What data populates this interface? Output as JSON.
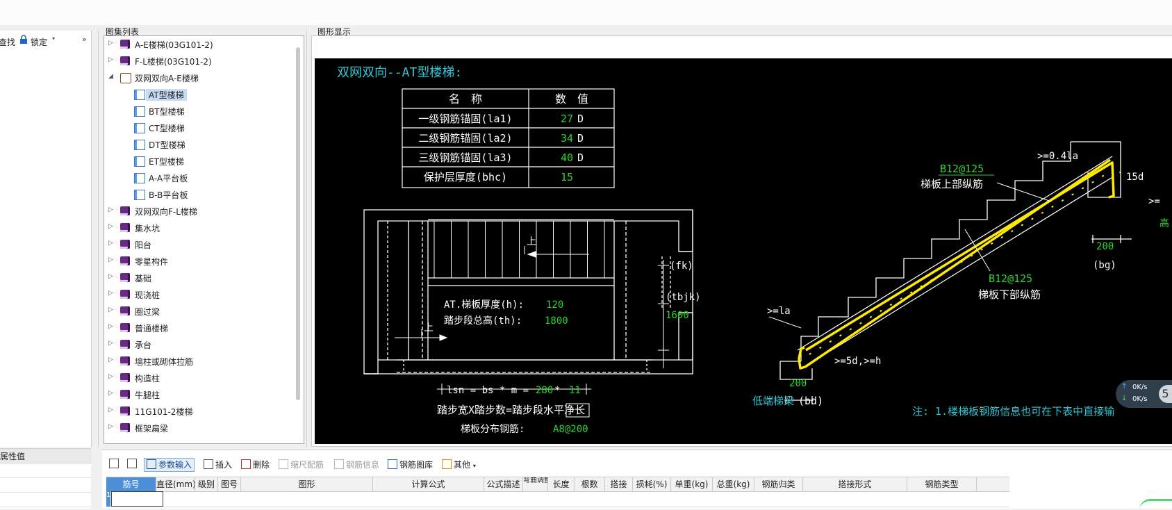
{
  "left_toolbar": {
    "find": "查找",
    "lock": "锁定"
  },
  "left_props": {
    "header": "属性值"
  },
  "tree_group_label": "图集列表",
  "graphic_group_label": "图形显示",
  "tree": [
    {
      "label": "A-E楼梯(03G101-2)",
      "level": 0,
      "expanded": false,
      "icon": "book-icon"
    },
    {
      "label": "F-L楼梯(03G101-2)",
      "level": 0,
      "expanded": false,
      "icon": "book-icon"
    },
    {
      "label": "双网双向A-E楼梯",
      "level": 0,
      "expanded": true,
      "icon": "open-book-icon"
    },
    {
      "label": "AT型楼梯",
      "level": 1,
      "selected": true,
      "icon": "page-icon"
    },
    {
      "label": "BT型楼梯",
      "level": 1,
      "icon": "page-icon"
    },
    {
      "label": "CT型楼梯",
      "level": 1,
      "icon": "page-icon"
    },
    {
      "label": "DT型楼梯",
      "level": 1,
      "icon": "page-icon"
    },
    {
      "label": "ET型楼梯",
      "level": 1,
      "icon": "page-icon"
    },
    {
      "label": "A-A平台板",
      "level": 1,
      "icon": "page-icon"
    },
    {
      "label": "B-B平台板",
      "level": 1,
      "icon": "page-icon"
    },
    {
      "label": "双网双向F-L楼梯",
      "level": 0,
      "expanded": false,
      "icon": "book-icon"
    },
    {
      "label": "集水坑",
      "level": 0,
      "expanded": false,
      "icon": "book-icon"
    },
    {
      "label": "阳台",
      "level": 0,
      "expanded": false,
      "icon": "book-icon"
    },
    {
      "label": "零星构件",
      "level": 0,
      "expanded": false,
      "icon": "book-icon"
    },
    {
      "label": "基础",
      "level": 0,
      "expanded": false,
      "icon": "book-icon"
    },
    {
      "label": "现浇桩",
      "level": 0,
      "expanded": false,
      "icon": "book-icon"
    },
    {
      "label": "圈过梁",
      "level": 0,
      "expanded": false,
      "icon": "book-icon"
    },
    {
      "label": "普通楼梯",
      "level": 0,
      "expanded": false,
      "icon": "book-icon"
    },
    {
      "label": "承台",
      "level": 0,
      "expanded": false,
      "icon": "book-icon"
    },
    {
      "label": "墙柱或砌体拉筋",
      "level": 0,
      "expanded": false,
      "icon": "book-icon"
    },
    {
      "label": "构造柱",
      "level": 0,
      "expanded": false,
      "icon": "book-icon"
    },
    {
      "label": "牛腿柱",
      "level": 0,
      "expanded": false,
      "icon": "book-icon"
    },
    {
      "label": "11G101-2楼梯",
      "level": 0,
      "expanded": false,
      "icon": "book-icon"
    },
    {
      "label": "框架扁梁",
      "level": 0,
      "expanded": false,
      "icon": "book-icon"
    }
  ],
  "drawing": {
    "title": "双网双向--AT型楼梯:",
    "table_headers": [
      "名　称",
      "数　值"
    ],
    "table_rows": [
      {
        "name": "一级钢筋锚固(la1)",
        "value": "27",
        "unit": "D"
      },
      {
        "name": "二级钢筋锚固(la2)",
        "value": "34",
        "unit": "D"
      },
      {
        "name": "三级钢筋锚固(la3)",
        "value": "40",
        "unit": "D"
      },
      {
        "name": "保护层厚度(bhc)",
        "value": "15",
        "unit": ""
      }
    ],
    "thickness_label": "AT.梯板厚度(h):",
    "thickness_value": "120",
    "height_label": "踏步段总高(th):",
    "height_value": "1800",
    "up1": "上",
    "up2": "上",
    "fk": "(fk)",
    "tbjk": "(tbjk)",
    "tbjk_value": "1600",
    "formula_prefix": "lsn = bs * m = ",
    "formula_bs": "280",
    "formula_mul": " * ",
    "formula_m": "11",
    "formula2": "踏步宽X踏步数=踏步段水平净长",
    "dist_label": "梯板分布钢筋:",
    "dist_value": "A8@200",
    "top_rebar_spec": "B12@125",
    "top_rebar_label": "梯板上部纵筋",
    "bot_rebar_spec": "B12@125",
    "bot_rebar_label": "梯板下部纵筋",
    "top_anchor": ">=0.4la",
    "end_15d": "15d",
    "ge_la": ">=la",
    "hook_5d": ">=5d,>=h",
    "bottom_200": "200",
    "top_200": "200",
    "bg": "(bg)",
    "bd_label_a": "低端梯梁",
    "bd_label_b": "(bd)",
    "note": "注: 1.楼梯板钢筋信息也可在下表中直接输",
    "gt_edge": ">=",
    "gao": "高"
  },
  "network": {
    "up": "0K/s",
    "down": "0K/s",
    "badge": "5"
  },
  "bottom_toolbar": [
    {
      "label": "",
      "name": "move-up-button",
      "enabled": true
    },
    {
      "label": "",
      "name": "move-down-button",
      "enabled": true
    },
    {
      "label": "参数输入",
      "name": "param-input-button",
      "enabled": true,
      "active": true
    },
    {
      "label": "插入",
      "name": "insert-button",
      "enabled": true
    },
    {
      "label": "删除",
      "name": "delete-button",
      "enabled": true
    },
    {
      "label": "缩尺配筋",
      "name": "scale-rebar-button",
      "enabled": false
    },
    {
      "label": "钢筋信息",
      "name": "rebar-info-button",
      "enabled": false
    },
    {
      "label": "钢筋图库",
      "name": "rebar-library-button",
      "enabled": true
    },
    {
      "label": "其他",
      "name": "other-dropdown",
      "enabled": true
    }
  ],
  "grid_headers": [
    "筋号",
    "直径(mm)",
    "级别",
    "图号",
    "图形",
    "计算公式",
    "公式描述",
    "弯曲调整",
    "长度",
    "根数",
    "搭接",
    "损耗(%)",
    "单重(kg)",
    "总重(kg)",
    "钢筋归类",
    "搭接形式",
    "钢筋类型"
  ],
  "grid_row_number": "1"
}
